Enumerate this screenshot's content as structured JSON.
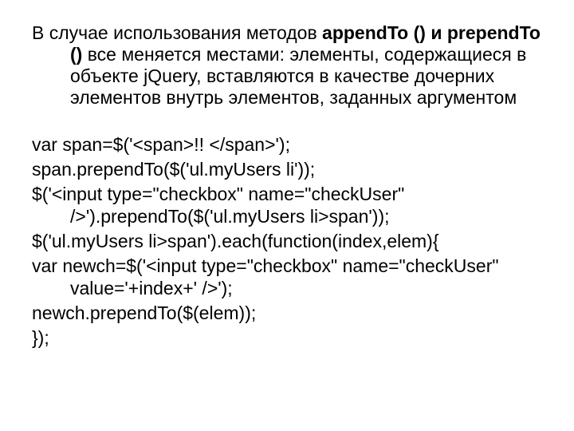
{
  "intro": {
    "pre": "В случае использования методов ",
    "bold": "appendTo () и prependTo ()",
    "post": " все меняется местами: элементы, содержащиеся в объекте jQuery, вставляются в качестве дочерних элементов внутрь элементов, заданных аргументом"
  },
  "code": {
    "l1": "var span=$('<span>!! </span>');",
    "l2": "span.prependTo($('ul.myUsers li'));",
    "l3": "$('<input type=\"checkbox\" name=\"checkUser\" />').prependTo($('ul.myUsers li>span'));",
    "l4": "$('ul.myUsers li>span').each(function(index,elem){",
    "l5": "var newch=$('<input type=\"checkbox\" name=\"checkUser\" value='+index+' />');",
    "l6": "newch.prependTo($(elem));",
    "l7": "});"
  }
}
